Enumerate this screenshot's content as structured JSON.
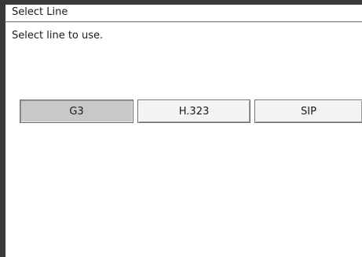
{
  "dialog": {
    "title": "Select Line",
    "message": "Select line to use."
  },
  "lines": {
    "g3_label": "G3",
    "h323_label": "H.323",
    "sip_label": "SIP",
    "selected": "G3"
  },
  "colors": {
    "frame": "#3a3a3a",
    "selected_button": "#c8c8c8",
    "button": "#f3f3f3",
    "background": "#ffffff"
  }
}
